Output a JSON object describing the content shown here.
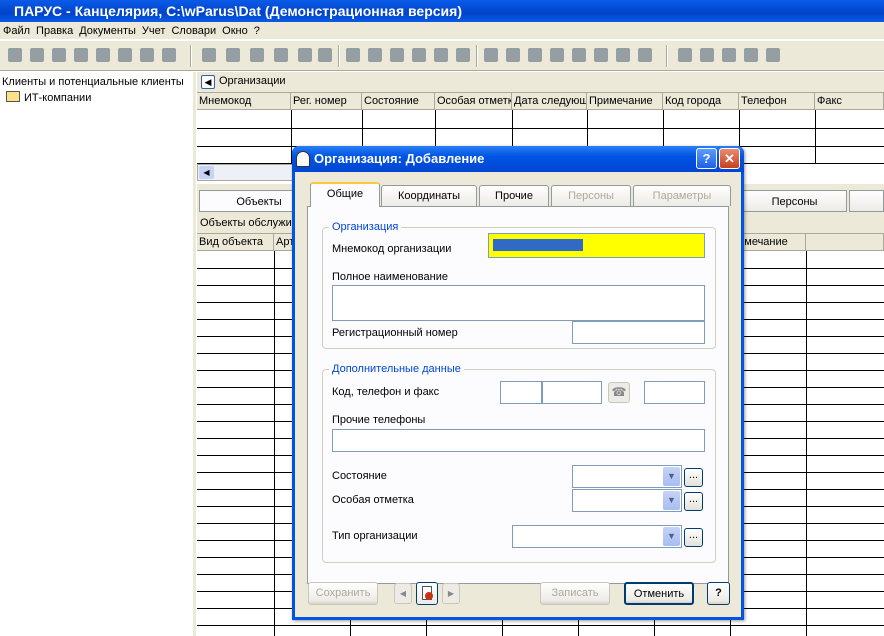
{
  "window": {
    "title": "ПАРУС - Канцелярия, C:\\wParus\\Dat (Демонстрационная версия)"
  },
  "menu": [
    "Файл",
    "Правка",
    "Документы",
    "Учет",
    "Словари",
    "Окно",
    "?"
  ],
  "tree": {
    "root": "Клиенты и потенциальные клиенты",
    "child": "ИТ-компании"
  },
  "orgs": {
    "header": "Организации",
    "columns": [
      "Мнемокод",
      "Рег. номер",
      "Состояние",
      "Особая отметка",
      "Дата следующ",
      "Примечание",
      "Код города",
      "Телефон",
      "Факс"
    ]
  },
  "lower": {
    "tab_objects": "Объекты",
    "tab_persons": "Персоны",
    "panel_title": "Объекты обслужи",
    "columns": [
      "Вид объекта",
      "Арт",
      "римечание"
    ]
  },
  "dialog": {
    "title": "Организация: Добавление",
    "tabs": [
      "Общие",
      "Координаты",
      "Прочие",
      "Персоны",
      "Параметры"
    ],
    "group_org": "Организация",
    "mnemo_label": "Мнемокод организации",
    "fullname_label": "Полное наименование",
    "regnum_label": "Регистрационный номер",
    "group_extra": "Дополнительные данные",
    "phone_label": "Код, телефон и факс",
    "other_phones_label": "Прочие телефоны",
    "state_label": "Состояние",
    "mark_label": "Особая отметка",
    "orgtype_label": "Тип организации",
    "save_btn": "Сохранить",
    "write_btn": "Записать",
    "cancel_btn": "Отменить",
    "help_btn": "?"
  },
  "colors": {
    "title_blue": "#0054e3",
    "highlight_yellow": "#ffff00",
    "selection_blue": "#316ac5"
  }
}
